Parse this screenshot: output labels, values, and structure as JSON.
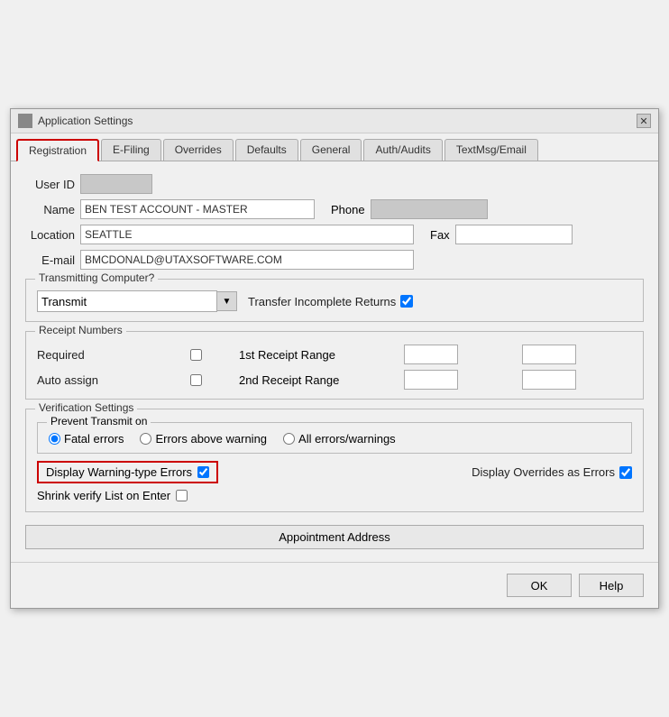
{
  "window": {
    "title": "Application Settings",
    "close_label": "✕"
  },
  "tabs": [
    {
      "label": "Registration",
      "active": true
    },
    {
      "label": "E-Filing",
      "active": false
    },
    {
      "label": "Overrides",
      "active": false
    },
    {
      "label": "Defaults",
      "active": false
    },
    {
      "label": "General",
      "active": false
    },
    {
      "label": "Auth/Audits",
      "active": false
    },
    {
      "label": "TextMsg/Email",
      "active": false
    }
  ],
  "form": {
    "user_id_label": "User ID",
    "name_label": "Name",
    "name_value": "BEN TEST ACCOUNT - MASTER",
    "location_label": "Location",
    "location_value": "SEATTLE",
    "email_label": "E-mail",
    "email_value": "BMCDONALD@UTAXSOFTWARE.COM",
    "phone_label": "Phone",
    "fax_label": "Fax"
  },
  "transmitting": {
    "section_title": "Transmitting Computer?",
    "select_value": "Transmit",
    "select_options": [
      "Transmit"
    ],
    "transfer_label": "Transfer Incomplete Returns",
    "transfer_checked": true
  },
  "receipt_numbers": {
    "section_title": "Receipt Numbers",
    "required_label": "Required",
    "required_checked": false,
    "auto_assign_label": "Auto assign",
    "auto_assign_checked": false,
    "first_range_label": "1st Receipt Range",
    "second_range_label": "2nd Receipt Range"
  },
  "verification": {
    "section_title": "Verification Settings",
    "prevent_transmit_title": "Prevent Transmit on",
    "radio_options": [
      {
        "label": "Fatal errors",
        "selected": true
      },
      {
        "label": "Errors above warning",
        "selected": false
      },
      {
        "label": "All errors/warnings",
        "selected": false
      }
    ],
    "display_warning_label": "Display Warning-type Errors",
    "display_warning_checked": true,
    "display_overrides_label": "Display Overrides as Errors",
    "display_overrides_checked": true,
    "shrink_verify_label": "Shrink verify List on Enter",
    "shrink_verify_checked": false
  },
  "appointment_button": "Appointment Address",
  "footer": {
    "ok_label": "OK",
    "help_label": "Help"
  }
}
